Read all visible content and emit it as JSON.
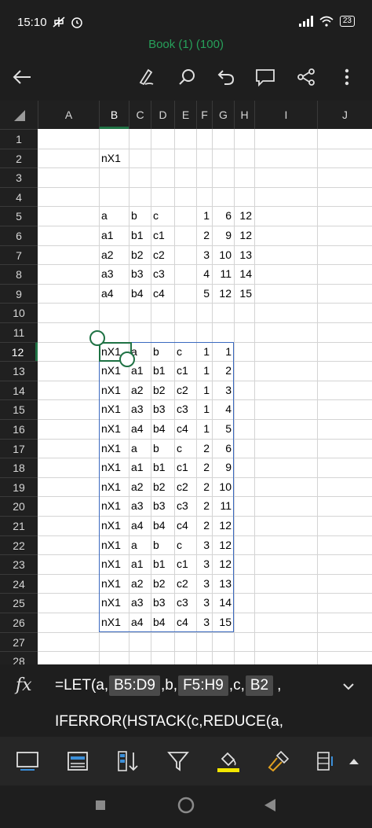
{
  "status": {
    "time": "15:10",
    "battery": "23"
  },
  "title": "Book (1) (100)",
  "columns": [
    "A",
    "B",
    "C",
    "D",
    "E",
    "F",
    "G",
    "H",
    "I",
    "J"
  ],
  "rows": [
    "1",
    "2",
    "3",
    "4",
    "5",
    "6",
    "7",
    "8",
    "9",
    "10",
    "11",
    "12",
    "13",
    "14",
    "15",
    "16",
    "17",
    "18",
    "19",
    "20",
    "21",
    "22",
    "23",
    "24",
    "25",
    "26",
    "27",
    "28"
  ],
  "cells": {
    "b2": "nX1",
    "source_table": [
      [
        "a",
        "b",
        "c",
        "1",
        "6",
        "12"
      ],
      [
        "a1",
        "b1",
        "c1",
        "2",
        "9",
        "12"
      ],
      [
        "a2",
        "b2",
        "c2",
        "3",
        "10",
        "13"
      ],
      [
        "a3",
        "b3",
        "c3",
        "4",
        "11",
        "14"
      ],
      [
        "a4",
        "b4",
        "c4",
        "5",
        "12",
        "15"
      ]
    ],
    "result_table": [
      [
        "nX1",
        "a",
        "b",
        "c",
        "1",
        "1"
      ],
      [
        "nX1",
        "a1",
        "b1",
        "c1",
        "1",
        "2"
      ],
      [
        "nX1",
        "a2",
        "b2",
        "c2",
        "1",
        "3"
      ],
      [
        "nX1",
        "a3",
        "b3",
        "c3",
        "1",
        "4"
      ],
      [
        "nX1",
        "a4",
        "b4",
        "c4",
        "1",
        "5"
      ],
      [
        "nX1",
        "a",
        "b",
        "c",
        "2",
        "6"
      ],
      [
        "nX1",
        "a1",
        "b1",
        "c1",
        "2",
        "9"
      ],
      [
        "nX1",
        "a2",
        "b2",
        "c2",
        "2",
        "10"
      ],
      [
        "nX1",
        "a3",
        "b3",
        "c3",
        "2",
        "11"
      ],
      [
        "nX1",
        "a4",
        "b4",
        "c4",
        "2",
        "12"
      ],
      [
        "nX1",
        "a",
        "b",
        "c",
        "3",
        "12"
      ],
      [
        "nX1",
        "a1",
        "b1",
        "c1",
        "3",
        "12"
      ],
      [
        "nX1",
        "a2",
        "b2",
        "c2",
        "3",
        "13"
      ],
      [
        "nX1",
        "a3",
        "b3",
        "c3",
        "3",
        "14"
      ],
      [
        "nX1",
        "a4",
        "b4",
        "c4",
        "3",
        "15"
      ]
    ]
  },
  "formula": {
    "fx": "fx",
    "p1": "=LET(a,",
    "ref1": "B5:D9",
    "p2": ",b,",
    "ref2": "F5:H9",
    "p3": ",c,",
    "ref3": "B2",
    "p4": ",",
    "line2": "IFERROR(HSTACK(c,REDUCE(a,"
  },
  "colors": {
    "accent": "#1f7244",
    "selection": "#3b6ac0",
    "title": "#27a05a"
  }
}
